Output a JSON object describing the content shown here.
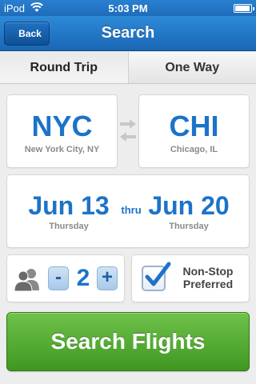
{
  "status_bar": {
    "carrier": "iPod",
    "time": "5:03 PM"
  },
  "nav": {
    "back_label": "Back",
    "title": "Search"
  },
  "tabs": [
    {
      "label": "Round Trip",
      "active": true
    },
    {
      "label": "One Way",
      "active": false
    }
  ],
  "trip": {
    "from": {
      "code": "NYC",
      "name": "New York City, NY"
    },
    "to": {
      "code": "CHI",
      "name": "Chicago, IL"
    },
    "depart": {
      "date": "Jun 13",
      "day": "Thursday"
    },
    "separator": "thru",
    "return": {
      "date": "Jun 20",
      "day": "Thursday"
    }
  },
  "passengers": {
    "count": "2",
    "minus_label": "-",
    "plus_label": "+"
  },
  "nonstop": {
    "label_line1": "Non-Stop",
    "label_line2": "Preferred",
    "checked": true
  },
  "search_button_label": "Search Flights",
  "colors": {
    "accent_blue": "#1c73c8",
    "nav_blue": "#1f6cbb",
    "search_green": "#4ea82c"
  },
  "icons": [
    "wifi-icon",
    "battery-icon",
    "swap-arrows-icon",
    "passenger-icon",
    "checkmark-icon"
  ]
}
